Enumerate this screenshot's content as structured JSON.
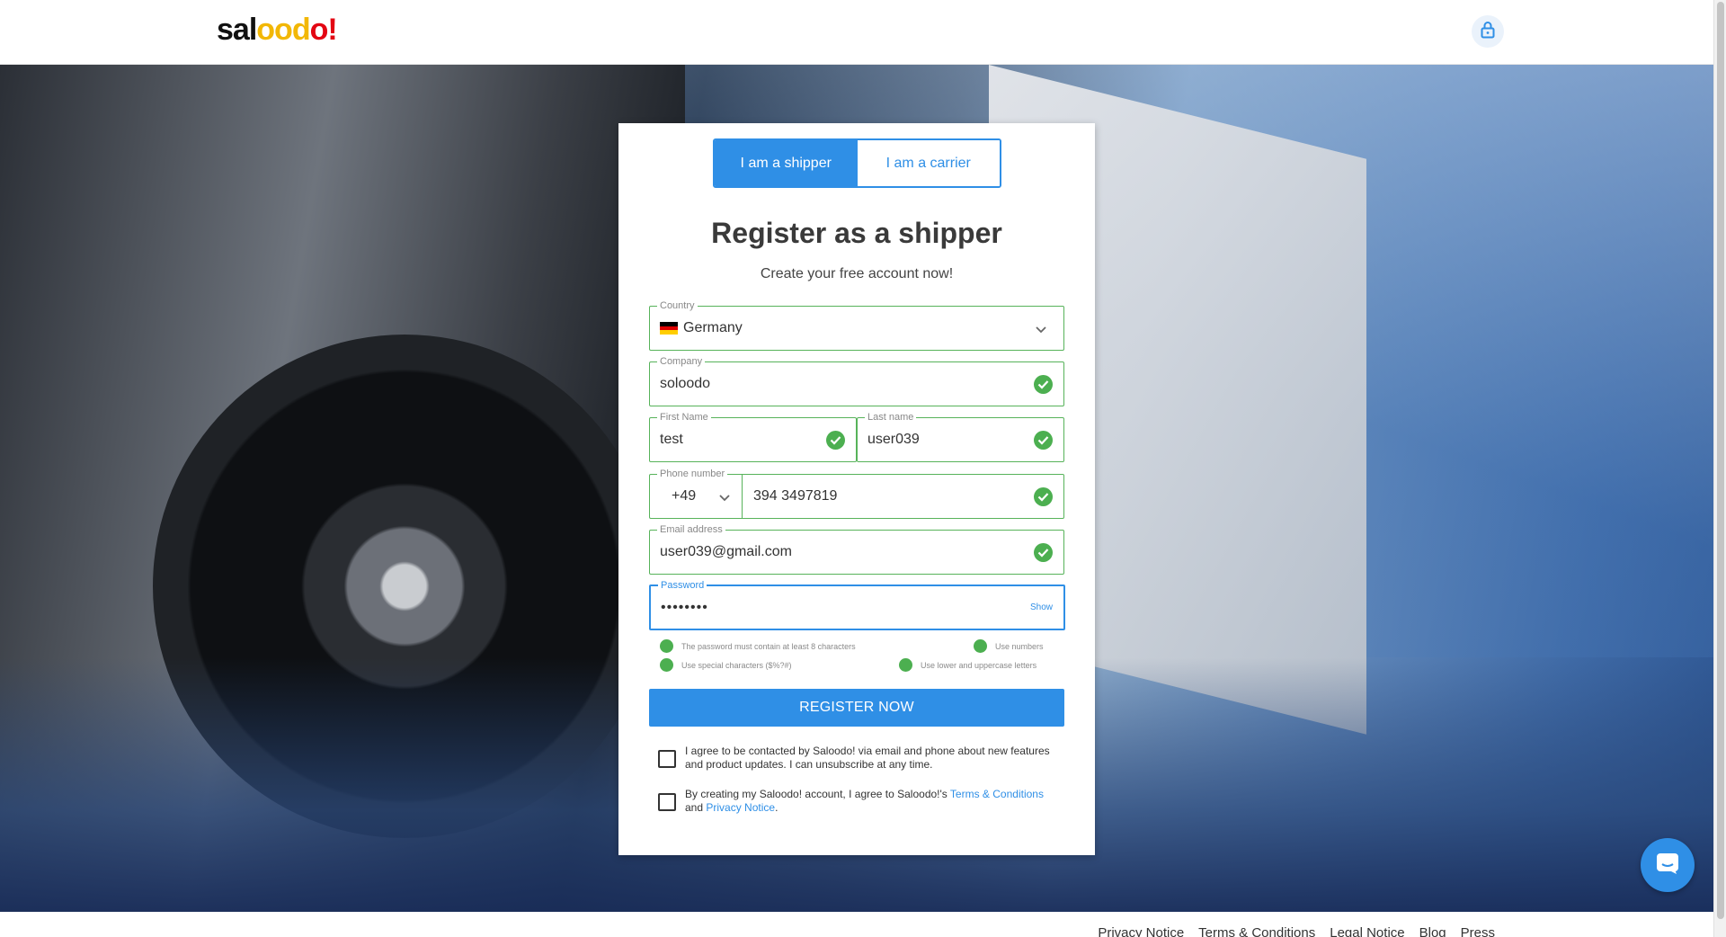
{
  "header": {
    "logo": {
      "p1": "sal",
      "p2": "oo",
      "p3": "d",
      "p4": "o",
      "p5": "!"
    }
  },
  "switch": {
    "shipper": "I am a shipper",
    "carrier": "I am a carrier"
  },
  "form": {
    "title": "Register as a shipper",
    "subtitle": "Create your free account now!",
    "country": {
      "label": "Country",
      "value": "Germany"
    },
    "company": {
      "label": "Company",
      "value": "soloodo"
    },
    "first_name": {
      "label": "First Name",
      "value": "test"
    },
    "last_name": {
      "label": "Last name",
      "value": "user039"
    },
    "phone": {
      "label": "Phone number",
      "code": "+49",
      "value": "394 3497819"
    },
    "email": {
      "label": "Email address",
      "value": "user039@gmail.com"
    },
    "password": {
      "label": "Password",
      "value": "••••••••",
      "show": "Show"
    },
    "rules": {
      "min_chars": "The password must contain at least 8 characters",
      "numbers": "Use numbers",
      "special": "Use special characters ($%?#)",
      "case": "Use lower and uppercase letters"
    },
    "register": "REGISTER NOW",
    "consent1": "I agree to be contacted by Saloodo! via email and phone about new features and product updates. I can unsubscribe at any time.",
    "consent2_prefix": "By creating my Saloodo! account, I agree to Saloodo!'s",
    "consent2_terms": "Terms & Conditions",
    "consent2_and": "and",
    "consent2_privacy": "Privacy Notice",
    "consent2_end": "."
  },
  "footer": {
    "links": [
      "Privacy Notice",
      "Terms & Conditions",
      "Legal Notice",
      "Blog",
      "Press"
    ]
  },
  "colors": {
    "accent": "#2f8fe6",
    "valid": "#4caf50",
    "logo_yellow": "#f2b705",
    "logo_red": "#e30613"
  },
  "icons": {
    "lock": "lock-icon",
    "check": "check-icon",
    "chevron": "chevron-down-icon",
    "chat": "chat-icon",
    "flag": "germany-flag-icon"
  }
}
